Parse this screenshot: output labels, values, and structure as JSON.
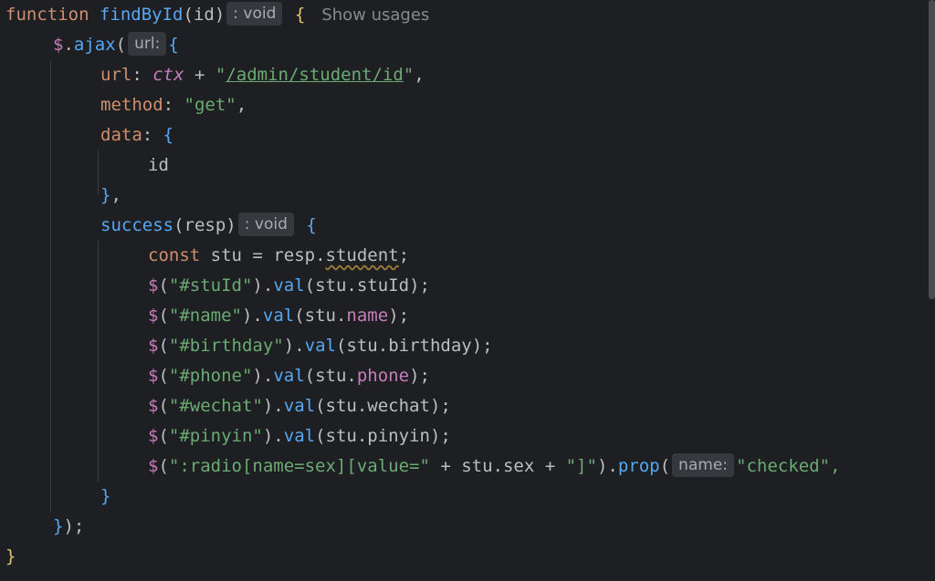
{
  "code": {
    "function_keyword": "function",
    "function_name": "findById",
    "param": "id",
    "void_hint": ": void",
    "usages_label": "Show usages",
    "ajax_call": "$.ajax",
    "url_hint": "url:",
    "url_key": "url",
    "ctx_var": "ctx",
    "url_value": "/admin/student/id",
    "method_key": "method",
    "method_value": "\"get\"",
    "data_key": "data",
    "data_value": "id",
    "success_key": "success",
    "success_param": "resp",
    "const_keyword": "const",
    "stu_var": "stu",
    "resp_student": "resp.",
    "student_prop": "student",
    "lines": [
      {
        "sel": "\"#stuId\"",
        "arg_obj": "stu.",
        "arg_prop": "stuId",
        "purple": false
      },
      {
        "sel": "\"#name\"",
        "arg_obj": "stu.",
        "arg_prop": "name",
        "purple": true
      },
      {
        "sel": "\"#birthday\"",
        "arg_obj": "stu.",
        "arg_prop": "birthday",
        "purple": false
      },
      {
        "sel": "\"#phone\"",
        "arg_obj": "stu.",
        "arg_prop": "phone",
        "purple": true
      },
      {
        "sel": "\"#wechat\"",
        "arg_obj": "stu.",
        "arg_prop": "wechat",
        "purple": false
      },
      {
        "sel": "\"#pinyin\"",
        "arg_obj": "stu.",
        "arg_prop": "pinyin",
        "purple": false
      }
    ],
    "val_method": "val",
    "radio_selector": "\":radio[name=sex][value=\"",
    "radio_concat": " + stu.sex + ",
    "radio_close": "\"]\"",
    "prop_method": "prop",
    "name_hint": "name:",
    "checked_value": "\"checked\","
  },
  "colors": {
    "background": "#1e1f22",
    "keyword": "#cf8e6d",
    "function": "#56a8f5",
    "string": "#6aab73",
    "property": "#c77dba",
    "plain": "#bcbec4"
  }
}
